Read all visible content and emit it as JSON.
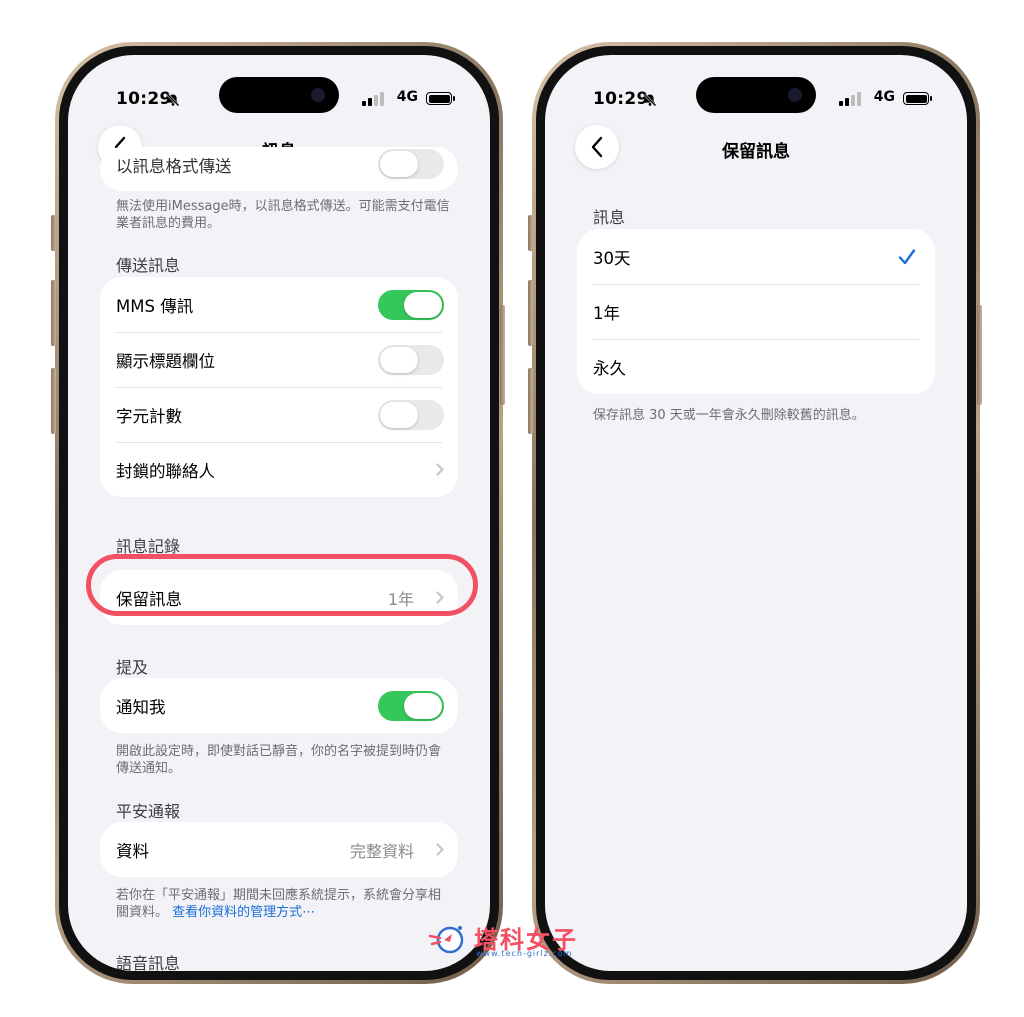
{
  "left_phone": {
    "status": {
      "time": "10:29",
      "network": "4G"
    },
    "nav": {
      "title": "訊息"
    },
    "partial_row": {
      "label": "以訊息格式傳送"
    },
    "sms_footnote": "無法使用iMessage時，以訊息格式傳送。可能需支付電信業者訊息的費用。",
    "send_section": {
      "header": "傳送訊息",
      "items": [
        {
          "label": "MMS 傳訊",
          "toggle": "on"
        },
        {
          "label": "顯示標題欄位",
          "toggle": "off"
        },
        {
          "label": "字元計數",
          "toggle": "off"
        },
        {
          "label": "封鎖的聯絡人"
        }
      ]
    },
    "history_section": {
      "header": "訊息記錄",
      "keep_label": "保留訊息",
      "keep_value": "1年"
    },
    "mentions_section": {
      "header": "提及",
      "notify_label": "通知我",
      "notify_toggle": "on",
      "footnote": "開啟此設定時，即使對話已靜音，你的名字被提到時仍會傳送通知。"
    },
    "check_in_section": {
      "header": "平安通報",
      "data_label": "資料",
      "data_value": "完整資料",
      "footnote": "若你在「平安通報」期間未回應系統提示，系統會分享相關資料。",
      "footnote_link": "查看你資料的管理方式⋯"
    },
    "audio_section": {
      "header": "語音訊息"
    }
  },
  "right_phone": {
    "status": {
      "time": "10:29",
      "network": "4G"
    },
    "nav": {
      "title": "保留訊息"
    },
    "section_header": "訊息",
    "options": [
      {
        "label": "30天",
        "selected": true
      },
      {
        "label": "1年",
        "selected": false
      },
      {
        "label": "永久",
        "selected": false
      }
    ],
    "footnote": "保存訊息 30 天或一年會永久刪除較舊的訊息。"
  },
  "watermark": {
    "text": "塔科女子",
    "url": "www.tech-girlz.com"
  },
  "colors": {
    "toggle_on": "#34c759",
    "checkmark": "#1a6fd8",
    "highlight": "#f25063",
    "background": "#f2f2f7"
  }
}
